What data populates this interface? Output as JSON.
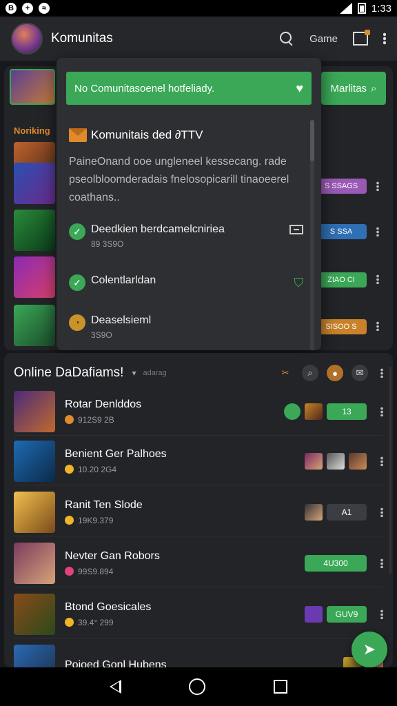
{
  "status_bar": {
    "time": "1:33",
    "left_icons": [
      "B",
      "app-icon",
      "circle-icon"
    ]
  },
  "app_bar": {
    "title": "Komunitas",
    "game_label": "Game"
  },
  "background": {
    "right_button_label": "Marlitas",
    "section_label": "Noriking",
    "pills": [
      {
        "label": "S SSAGS",
        "color": "#9b59b6"
      },
      {
        "label": "S SSA",
        "color": "#2f6fb3"
      },
      {
        "label": "ZIAO CI",
        "color": "#3aa856"
      },
      {
        "label": "SISOO S",
        "color": "#c9822a"
      }
    ]
  },
  "modal": {
    "banner_text": "No Comunitasoenel hotfeliady.",
    "title": "Komunitais ded ∂TTV",
    "description": "PaineOnand ooe ungleneel kessecang. rade pseolbloomderadais fnelosopicarill tinaoeerel coathans..",
    "options": [
      {
        "label": "Deedkien berdcamelcniriea",
        "sub": "89 3S9O",
        "icon": "check-icon",
        "trail": "card-icon"
      },
      {
        "label": "Colentlarldan",
        "sub": "",
        "icon": "check-icon",
        "trail": "shirt-icon"
      },
      {
        "label": "Deaselsieml",
        "sub": "3S9O",
        "icon": "timer-icon",
        "trail": ""
      }
    ]
  },
  "online": {
    "title": "Online DaDafiams!",
    "filter_hint": "adarag",
    "rows": [
      {
        "name": "Rotar Denlddos",
        "sub": "912S9 2B",
        "sub_color": "#e08a2c",
        "pill": "13",
        "pill_color": "#3aa856",
        "thumb_a": "#4b2a7a",
        "thumb_b": "#c06a2c"
      },
      {
        "name": "Benient Ger Palhoes",
        "sub": "10.20 2G4",
        "sub_color": "#f0b429",
        "pill": "",
        "pill_color": "",
        "thumb_a": "#1e6bb3",
        "thumb_b": "#0b2a4a"
      },
      {
        "name": "Ranit Ten Slode",
        "sub": "19K9.379",
        "sub_color": "#f0b429",
        "pill": "A1",
        "pill_color": "#3c3d42",
        "thumb_a": "#f2c14e",
        "thumb_b": "#7a4a1a"
      },
      {
        "name": "Nevter Gan Robors",
        "sub": "99S9.894",
        "sub_color": "#e0447a",
        "pill": "4U300",
        "pill_color": "#3aa856",
        "thumb_a": "#7a3b5e",
        "thumb_b": "#d7a37a"
      },
      {
        "name": "Btond Goesicales",
        "sub": "39.4° 299",
        "sub_color": "#f0b429",
        "pill": "GUV9",
        "pill_color": "#3aa856",
        "thumb_a": "#8a4a1a",
        "thumb_b": "#2b4a1a"
      },
      {
        "name": "Poioed Gonl Hubens",
        "sub": "",
        "sub_color": "#f0b429",
        "pill": "",
        "pill_color": "",
        "thumb_a": "#2a6ab3",
        "thumb_b": "#1b2e4a"
      }
    ]
  },
  "colors": {
    "accent_green": "#3aa856",
    "accent_orange": "#e08a2c",
    "surface": "#232428"
  }
}
